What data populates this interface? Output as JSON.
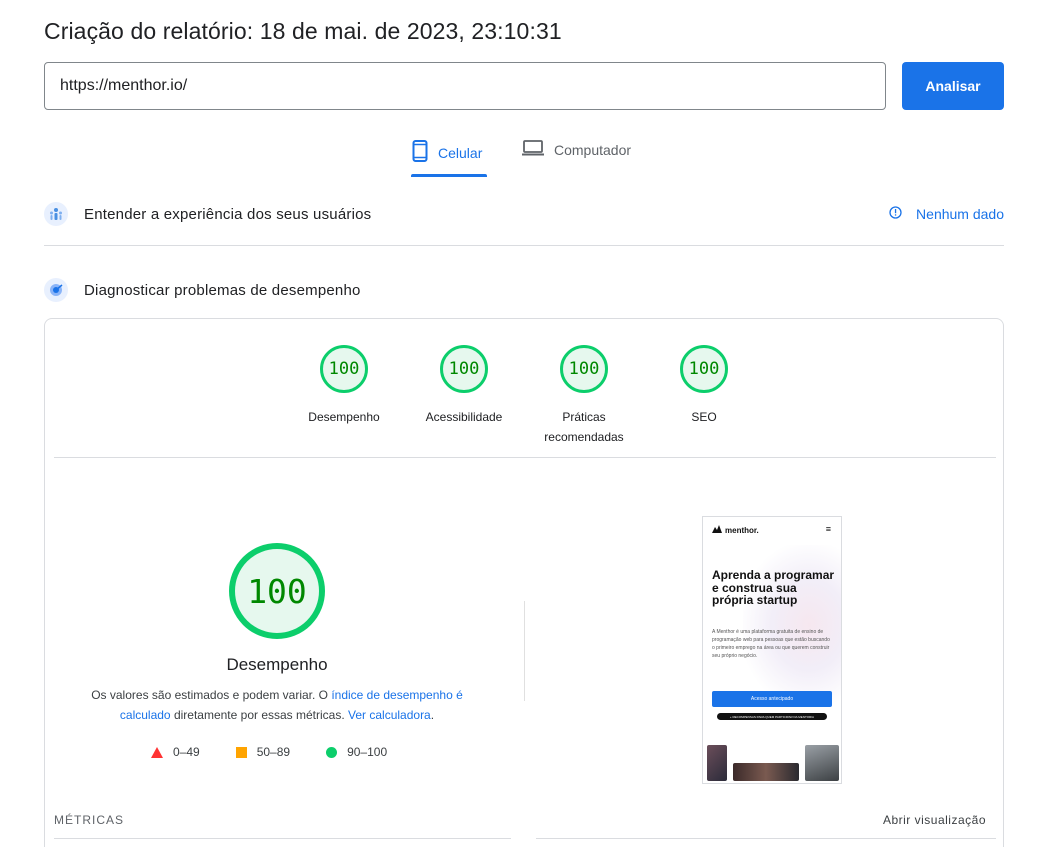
{
  "report": {
    "title": "Criação do relatório: 18 de mai. de 2023, 23:10:31"
  },
  "search": {
    "url_value": "https://menthor.io/",
    "analyze_label": "Analisar"
  },
  "tabs": [
    {
      "label": "Celular",
      "icon": "smartphone-icon",
      "active": true
    },
    {
      "label": "Computador",
      "icon": "laptop-icon",
      "active": false
    }
  ],
  "field_data": {
    "title": "Entender a experiência dos seus usuários",
    "status": "Nenhum dado",
    "icon": "users-experience-icon"
  },
  "lab_data": {
    "title": "Diagnosticar problemas de desempenho",
    "icon": "lighthouse-icon"
  },
  "categories": [
    {
      "score": "100",
      "label": "Desempenho"
    },
    {
      "score": "100",
      "label": "Acessibilidade"
    },
    {
      "score": "100",
      "label": "Práticas recomendadas"
    },
    {
      "score": "100",
      "label": "SEO"
    }
  ],
  "performance": {
    "score": "100",
    "label": "Desempenho",
    "desc_prefix": "Os valores são estimados e podem variar. O ",
    "desc_link1": "índice de desempenho é calculado",
    "desc_mid": " diretamente por essas métricas. ",
    "desc_link2": "Ver calculadora",
    "desc_suffix": "."
  },
  "legend": [
    {
      "range": "0–49",
      "shape": "triangle",
      "color": "#ff3333"
    },
    {
      "range": "50–89",
      "shape": "square",
      "color": "#ffa400"
    },
    {
      "range": "90–100",
      "shape": "circle",
      "color": "#0cce6b"
    }
  ],
  "screenshot": {
    "brand": "menthor.",
    "headline": "Aprenda a programar e construa sua própria startup",
    "body": "A Menthor é uma plataforma gratuita de ensino de programação web para pessoas que estão buscando o primeiro emprego na área ou que querem construir seu próprio negócio.",
    "cta": "Acesso antecipado",
    "cta_secondary": "+ RECOMPENSAS PARA QUEM PARTICIPAR DA MENTORIA"
  },
  "metrics": {
    "label": "MÉTRICAS",
    "open_view": "Abrir visualização"
  },
  "colors": {
    "accent": "#1a73e8",
    "pass": "#0cce6b",
    "pass_text": "#008800"
  }
}
